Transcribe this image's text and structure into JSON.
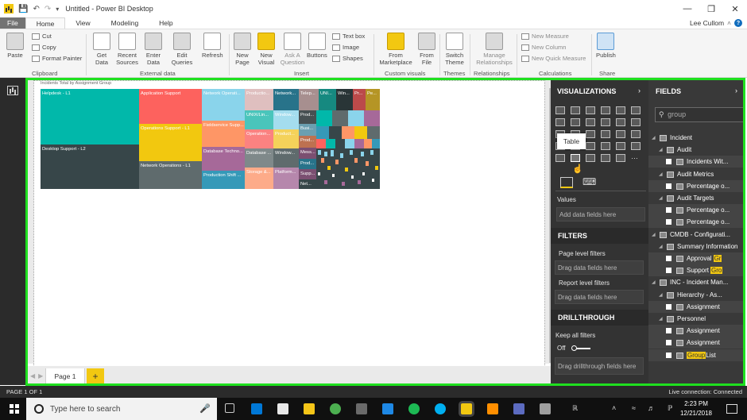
{
  "window": {
    "title": "Untitled - Power BI Desktop",
    "user": "Lee Cullom"
  },
  "tabs": [
    "File",
    "Home",
    "View",
    "Modeling",
    "Help"
  ],
  "ribbon": {
    "clipboard": {
      "paste": "Paste",
      "cut": "Cut",
      "copy": "Copy",
      "format_painter": "Format Painter",
      "label": "Clipboard"
    },
    "external": {
      "get_data": "Get Data",
      "recent_sources": "Recent Sources",
      "enter_data": "Enter Data",
      "edit_queries": "Edit Queries",
      "refresh": "Refresh",
      "label": "External data"
    },
    "insert": {
      "new_page": "New Page",
      "new_visual": "New Visual",
      "ask_question": "Ask A Question",
      "buttons": "Buttons",
      "text_box": "Text box",
      "image": "Image",
      "shapes": "Shapes",
      "label": "Insert"
    },
    "custom": {
      "from_marketplace": "From Marketplace",
      "from_file": "From File",
      "label": "Custom visuals"
    },
    "themes": {
      "switch_theme": "Switch Theme",
      "label": "Themes"
    },
    "relationships": {
      "manage": "Manage Relationships",
      "label": "Relationships"
    },
    "calculations": {
      "new_measure": "New Measure",
      "new_column": "New Column",
      "new_quick_measure": "New Quick Measure",
      "label": "Calculations"
    },
    "share": {
      "publish": "Publish",
      "label": "Share"
    }
  },
  "treemap": {
    "title": "Incidents Total by Assignment Group",
    "cells": [
      {
        "label": "Helpdesk - L1",
        "color": "#01b8aa"
      },
      {
        "label": "Desktop Support - L2",
        "color": "#374649"
      },
      {
        "label": "Application Support",
        "color": "#fd625e"
      },
      {
        "label": "Operations Support - L1",
        "color": "#f2c80f"
      },
      {
        "label": "Network Operations - L1",
        "color": "#5f6b6d"
      },
      {
        "label": "Network Operati...",
        "color": "#8ad4eb"
      },
      {
        "label": "Fieldservice Supp...",
        "color": "#fe9666"
      },
      {
        "label": "Database Techno...",
        "color": "#a66999"
      },
      {
        "label": "Production Shift ...",
        "color": "#3599b8"
      },
      {
        "label": "Productio...",
        "color": "#dfbfbf"
      },
      {
        "label": "UNIX/Lin...",
        "color": "#4ac5bb"
      },
      {
        "label": "Window...",
        "color": "#5f6b6d"
      },
      {
        "label": "Operation...",
        "color": "#fb8281"
      },
      {
        "label": "Product...",
        "color": "#f4d25a"
      },
      {
        "label": "Database ...",
        "color": "#7f898a"
      },
      {
        "label": "Window...",
        "color": "#a4ddee"
      },
      {
        "label": "Storage &...",
        "color": "#fdab89"
      },
      {
        "label": "Platform...",
        "color": "#b687ac"
      },
      {
        "label": "Network...",
        "color": "#28738a"
      },
      {
        "label": "Telep...",
        "color": "#a78f8f"
      },
      {
        "label": "UNI...",
        "color": "#168980"
      },
      {
        "label": "Win...",
        "color": "#293537"
      },
      {
        "label": "Pr...",
        "color": "#bb4a4a"
      },
      {
        "label": "Pe...",
        "color": "#b59525"
      },
      {
        "label": "Prod...",
        "color": "#475052"
      },
      {
        "label": "Busi...",
        "color": "#6a9fb0"
      },
      {
        "label": "Prod...",
        "color": "#bd7150"
      },
      {
        "label": "Mess...",
        "color": "#7b4f71"
      },
      {
        "label": "Prod...",
        "color": "#28738a"
      },
      {
        "label": "Supp...",
        "color": "#7b4f71"
      },
      {
        "label": "Net...",
        "color": "#374649"
      }
    ]
  },
  "viz_pane": {
    "title": "VISUALIZATIONS",
    "tooltip": "Table",
    "values_label": "Values",
    "values_placeholder": "Add data fields here",
    "filters_title": "FILTERS",
    "page_filters": "Page level filters",
    "page_filters_placeholder": "Drag data fields here",
    "report_filters": "Report level filters",
    "report_filters_placeholder": "Drag data fields here",
    "drillthrough_title": "DRILLTHROUGH",
    "keep_filters": "Keep all filters",
    "keep_filters_state": "Off",
    "drill_placeholder": "Drag drillthrough fields here"
  },
  "fields_pane": {
    "title": "FIELDS",
    "search_value": "group",
    "rows": [
      {
        "text": "Incident",
        "indent": 0,
        "type": "table"
      },
      {
        "text": "Audit",
        "indent": 1,
        "type": "folder"
      },
      {
        "text": "Incidents Wit...",
        "indent": 2,
        "type": "field"
      },
      {
        "text": "Audit Metrics",
        "indent": 1,
        "type": "folder"
      },
      {
        "text": "Percentage o...",
        "indent": 2,
        "type": "field"
      },
      {
        "text": "Audit Targets",
        "indent": 1,
        "type": "folder"
      },
      {
        "text": "Percentage o...",
        "indent": 2,
        "type": "field"
      },
      {
        "text": "Percentage o...",
        "indent": 2,
        "type": "field"
      },
      {
        "text": "CMDB - Configurati...",
        "indent": 0,
        "type": "table"
      },
      {
        "text": "Summary Information",
        "indent": 1,
        "type": "folder"
      },
      {
        "text": "Approval",
        "indent": 2,
        "type": "field",
        "hl": "Gr"
      },
      {
        "text": "Support",
        "indent": 2,
        "type": "field",
        "hl": "Gro"
      },
      {
        "text": "INC - Incident Man...",
        "indent": 0,
        "type": "table"
      },
      {
        "text": "Hierarchy - As...",
        "indent": 1,
        "type": "hier"
      },
      {
        "text": "Assignment",
        "indent": 2,
        "type": "field",
        "hl": " "
      },
      {
        "text": "Personnel",
        "indent": 1,
        "type": "folder"
      },
      {
        "text": "Assignment",
        "indent": 2,
        "type": "field",
        "hl": " "
      },
      {
        "text": "Assignment",
        "indent": 2,
        "type": "field",
        "hl": " "
      },
      {
        "text": "List",
        "indent": 2,
        "type": "field",
        "hlpre": "Group"
      }
    ]
  },
  "page_tab": "Page 1",
  "add_page": "+",
  "status": {
    "page": "PAGE 1 OF 1",
    "connection": "Live connection: Connected"
  },
  "taskbar": {
    "search_placeholder": "Type here to search",
    "time": "2:23 PM",
    "date": "12/21/2018"
  }
}
